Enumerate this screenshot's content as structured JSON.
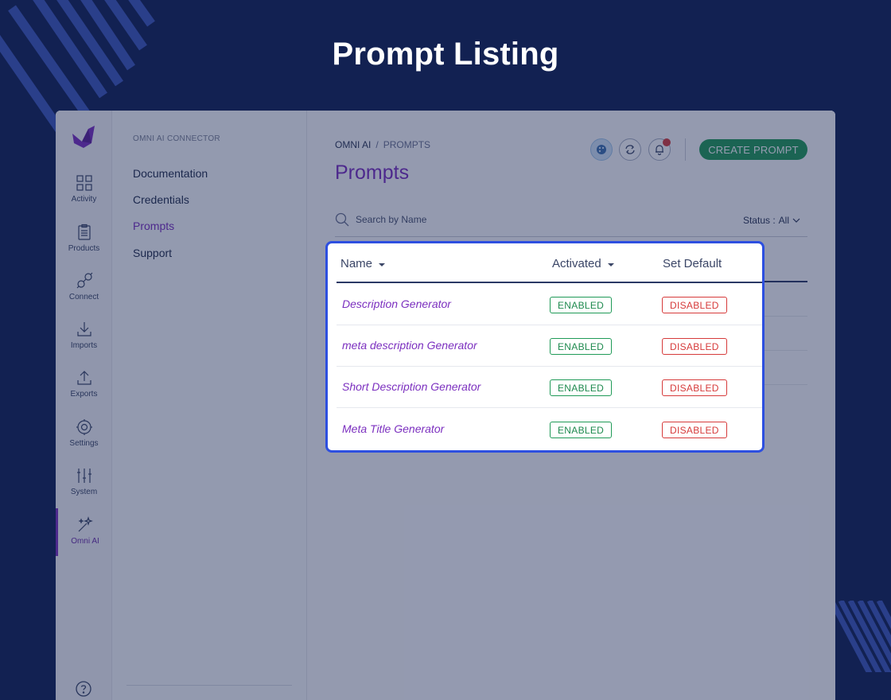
{
  "headline": "Prompt Listing",
  "rail": {
    "items": [
      {
        "label": "Activity",
        "icon": "grid-icon"
      },
      {
        "label": "Products",
        "icon": "clipboard-icon"
      },
      {
        "label": "Connect",
        "icon": "plug-icon"
      },
      {
        "label": "Imports",
        "icon": "download-icon"
      },
      {
        "label": "Exports",
        "icon": "upload-icon"
      },
      {
        "label": "Settings",
        "icon": "gear-icon"
      },
      {
        "label": "System",
        "icon": "sliders-icon"
      },
      {
        "label": "Omni AI",
        "icon": "magic-wand-icon"
      }
    ],
    "active": "Omni AI",
    "help_icon": "help-circle-icon"
  },
  "submenu": {
    "title": "OMNI AI CONNECTOR",
    "items": [
      {
        "label": "Documentation"
      },
      {
        "label": "Credentials"
      },
      {
        "label": "Prompts"
      },
      {
        "label": "Support"
      }
    ],
    "active": "Prompts"
  },
  "breadcrumb": {
    "root": "OMNI AI",
    "separator": "/",
    "current": "PROMPTS"
  },
  "page_title": "Prompts",
  "toolbar": {
    "create_label": "CREATE PROMPT"
  },
  "search": {
    "placeholder": "Search by Name"
  },
  "status_filter": {
    "label": "Status :",
    "value": "All"
  },
  "table": {
    "columns": [
      {
        "label": "Name",
        "sortable": true
      },
      {
        "label": "Activated",
        "sortable": true
      },
      {
        "label": "Set Default",
        "sortable": false
      }
    ],
    "rows": [
      {
        "name": "Description Generator",
        "activated": "ENABLED",
        "default": "DISABLED"
      },
      {
        "name": "meta description Generator",
        "activated": "ENABLED",
        "default": "DISABLED"
      },
      {
        "name": "Short Description Generator",
        "activated": "ENABLED",
        "default": "DISABLED"
      },
      {
        "name": "Meta Title Generator",
        "activated": "ENABLED",
        "default": "DISABLED"
      }
    ]
  },
  "colors": {
    "background": "#122152",
    "accent": "#7b2fbf",
    "create_button": "#1f9a57",
    "enabled": "#1f9a57",
    "disabled": "#d63a3a",
    "highlight_border": "#2d4fe0"
  }
}
